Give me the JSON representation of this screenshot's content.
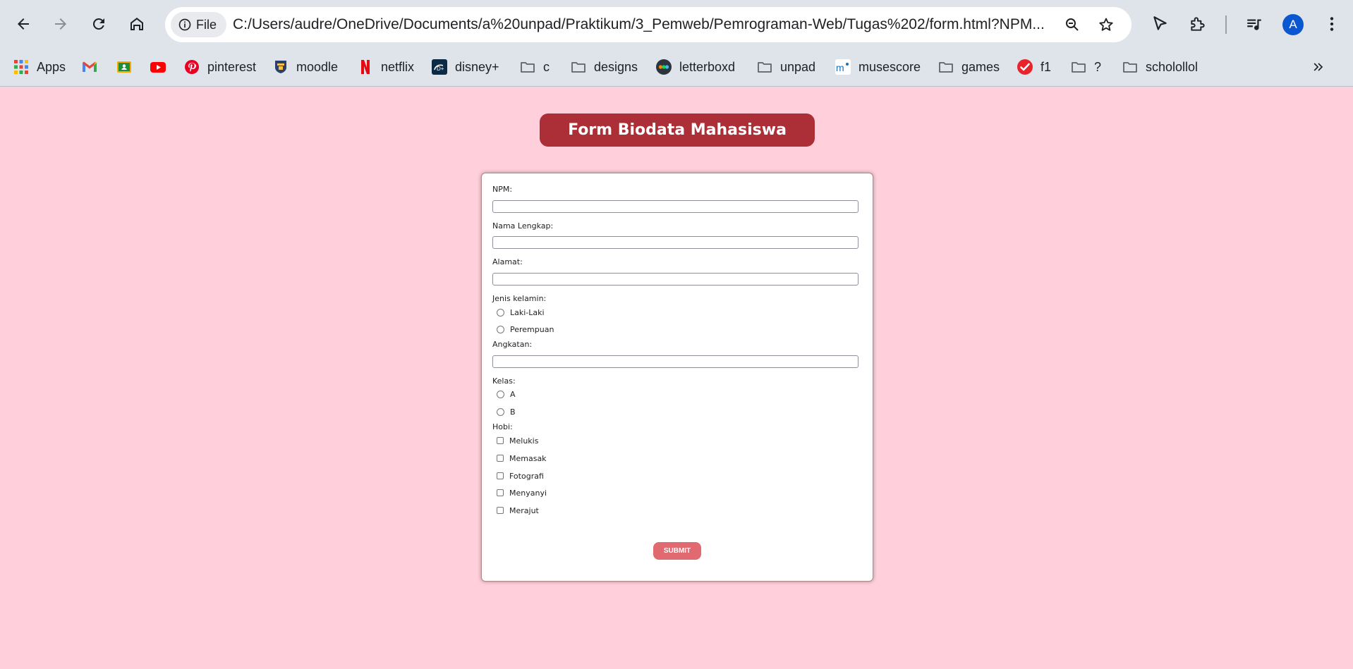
{
  "browser": {
    "file_chip_label": "File",
    "url": "C:/Users/audre/OneDrive/Documents/a%20unpad/Praktikum/3_Pemweb/Pemrograman-Web/Tugas%202/form.html?NPM...",
    "avatar_letter": "A",
    "accent": "#0b57d0"
  },
  "bookmarks": [
    {
      "label": "Apps",
      "icon": "apps-grid-icon"
    },
    {
      "label": "",
      "icon": "gmail-icon"
    },
    {
      "label": "",
      "icon": "google-classroom-icon"
    },
    {
      "label": "",
      "icon": "youtube-icon"
    },
    {
      "label": "pinterest",
      "icon": "pinterest-icon"
    },
    {
      "label": "moodle",
      "icon": "moodle-icon"
    },
    {
      "label": "netflix",
      "icon": "netflix-icon"
    },
    {
      "label": "disney+",
      "icon": "disney-plus-icon"
    },
    {
      "label": "c",
      "icon": "folder-icon"
    },
    {
      "label": "designs",
      "icon": "folder-icon"
    },
    {
      "label": "letterboxd",
      "icon": "letterboxd-icon"
    },
    {
      "label": "unpad",
      "icon": "folder-icon"
    },
    {
      "label": "musescore",
      "icon": "musescore-icon"
    },
    {
      "label": "games",
      "icon": "folder-icon"
    },
    {
      "label": "f1",
      "icon": "f1-check-icon"
    },
    {
      "label": "?",
      "icon": "folder-icon"
    },
    {
      "label": "scholollol",
      "icon": "folder-icon"
    }
  ],
  "page": {
    "title": "Form Biodata Mahasiswa",
    "background": "#ffd0dc",
    "title_color": "#ac2e36",
    "submit_color": "#e06a6f"
  },
  "form": {
    "npm_label": "NPM:",
    "nama_label": "Nama Lengkap:",
    "alamat_label": "Alamat:",
    "gender_label": "Jenis kelamin:",
    "gender_options": [
      "Laki-Laki",
      "Perempuan"
    ],
    "angkatan_label": "Angkatan:",
    "kelas_label": "Kelas:",
    "kelas_options": [
      "A",
      "B"
    ],
    "hobi_label": "Hobi:",
    "hobi_options": [
      "Melukis",
      "Memasak",
      "Fotografi",
      "Menyanyi",
      "Merajut"
    ],
    "submit_label": "SUBMIT"
  }
}
